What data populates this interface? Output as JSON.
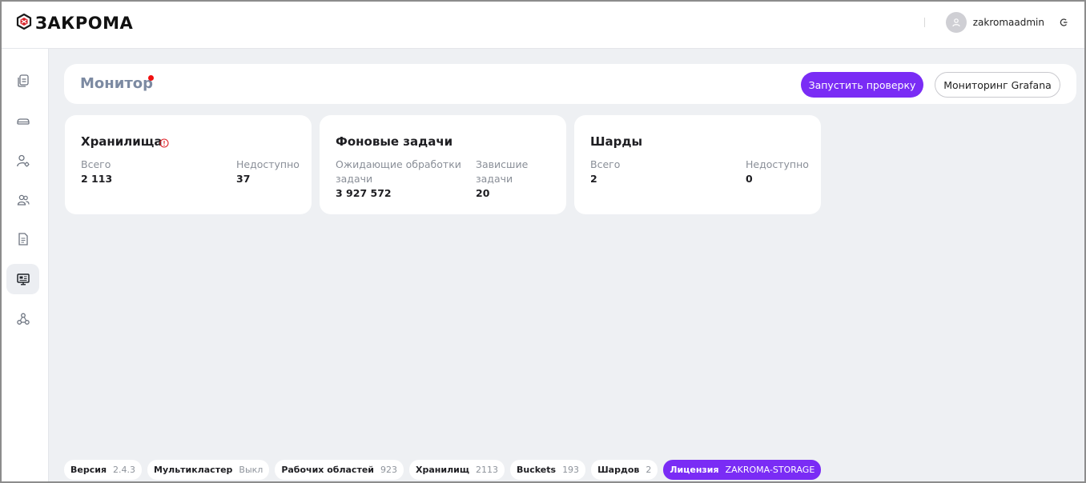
{
  "app": {
    "logo_text": "ЗАКРОМА"
  },
  "header": {
    "username": "zakromaadmin"
  },
  "sidebar": {
    "items": [
      {
        "name": "documents-icon"
      },
      {
        "name": "drive-icon"
      },
      {
        "name": "user-settings-icon"
      },
      {
        "name": "users-icon"
      },
      {
        "name": "file-icon"
      },
      {
        "name": "monitor-icon",
        "active": true
      },
      {
        "name": "cluster-icon"
      }
    ]
  },
  "page": {
    "title": "Монитор",
    "run_check_label": "Запустить проверку",
    "grafana_label": "Мониторинг Grafana"
  },
  "cards": {
    "storages": {
      "title": "Хранилища",
      "total_label": "Всего",
      "total_value": "2 113",
      "unavailable_label": "Недоступно",
      "unavailable_value": "37"
    },
    "jobs": {
      "title": "Фоновые задачи",
      "pending_label": "Ожидающие обработки задачи",
      "pending_value": "3 927 572",
      "stuck_label": "Зависшие задачи",
      "stuck_value": "20"
    },
    "shards": {
      "title": "Шарды",
      "total_label": "Всего",
      "total_value": "2",
      "unavailable_label": "Недоступно",
      "unavailable_value": "0"
    }
  },
  "footer": {
    "version": {
      "label": "Версия",
      "value": "2.4.3"
    },
    "multicluster": {
      "label": "Мультикластер",
      "value": "Выкл"
    },
    "workspaces": {
      "label": "Рабочих областей",
      "value": "923"
    },
    "storages": {
      "label": "Хранилищ",
      "value": "2113"
    },
    "buckets": {
      "label": "Buckets",
      "value": "193"
    },
    "shards": {
      "label": "Шардов",
      "value": "2"
    },
    "license": {
      "label": "Лицензия",
      "value": "ZAKROMA-STORAGE"
    }
  },
  "colors": {
    "accent": "#7a2cf5",
    "alert": "#f01010",
    "background": "#eef0f3"
  }
}
